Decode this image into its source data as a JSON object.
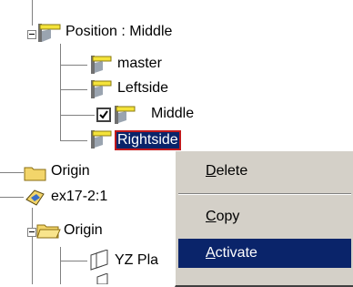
{
  "tree": {
    "position_node": {
      "label": "Position : Middle",
      "icon": "position-flag-icon"
    },
    "children": [
      {
        "label": "master",
        "icon": "position-flag-icon"
      },
      {
        "label": "Leftside",
        "icon": "position-flag-icon"
      },
      {
        "label": "Middle",
        "icon": "position-flag-icon",
        "checked": true
      },
      {
        "label": "Rightside",
        "icon": "position-flag-icon",
        "selected": true
      }
    ],
    "origin_node": {
      "label": "Origin",
      "icon": "folder-icon"
    },
    "part_node": {
      "label": "ex17-2:1",
      "icon": "part-icon"
    },
    "part_origin_node": {
      "label": "Origin",
      "icon": "folder-open-icon"
    },
    "plane_node": {
      "label": "YZ Pla",
      "icon": "plane-icon"
    }
  },
  "context_menu": {
    "items": [
      {
        "mnemonic": "D",
        "rest": "elete"
      },
      {
        "mnemonic": "C",
        "rest": "opy"
      },
      {
        "mnemonic": "A",
        "rest": "ctivate",
        "highlighted": true
      }
    ]
  },
  "colors": {
    "selection": "#0a246a",
    "selection_outline": "#c0181c",
    "menu_background": "#d4d0c8",
    "tree_lines": "#808080"
  }
}
